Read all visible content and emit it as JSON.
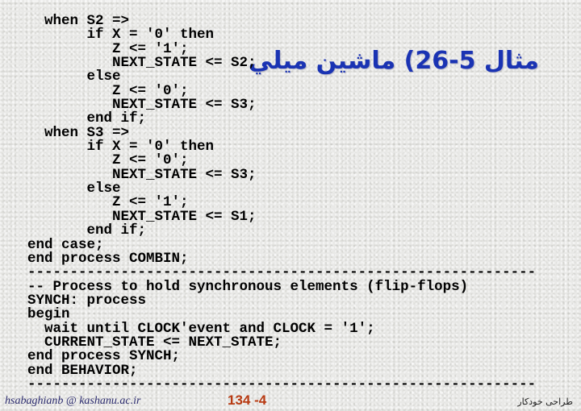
{
  "slide": {
    "title": "مثال 5-26) ماشین میلي",
    "title_color": "#1a33b3",
    "code_lines": [
      "  when S2 =>",
      "       if X = '0' then",
      "          Z <= '1';",
      "          NEXT_STATE <= S2;",
      "       else",
      "          Z <= '0';",
      "          NEXT_STATE <= S3;",
      "       end if;",
      "  when S3 =>",
      "       if X = '0' then",
      "          Z <= '0';",
      "          NEXT_STATE <= S3;",
      "       else",
      "          Z <= '1';",
      "          NEXT_STATE <= S1;",
      "       end if;",
      "end case;",
      "end process COMBIN;",
      "------------------------------------------------------------",
      "-- Process to hold synchronous elements (flip-flops)",
      "SYNCH: process",
      "begin",
      "  wait until CLOCK'event and CLOCK = '1';",
      "  CURRENT_STATE <= NEXT_STATE;",
      "end process SYNCH;",
      "end BEHAVIOR;",
      "------------------------------------------------------------"
    ]
  },
  "footer": {
    "email": "hsabaghianb @ kashanu.ac.ir",
    "page_number": "134 -4",
    "page_number_color": "#b83a12",
    "right_text": "طراحی خودکار"
  }
}
